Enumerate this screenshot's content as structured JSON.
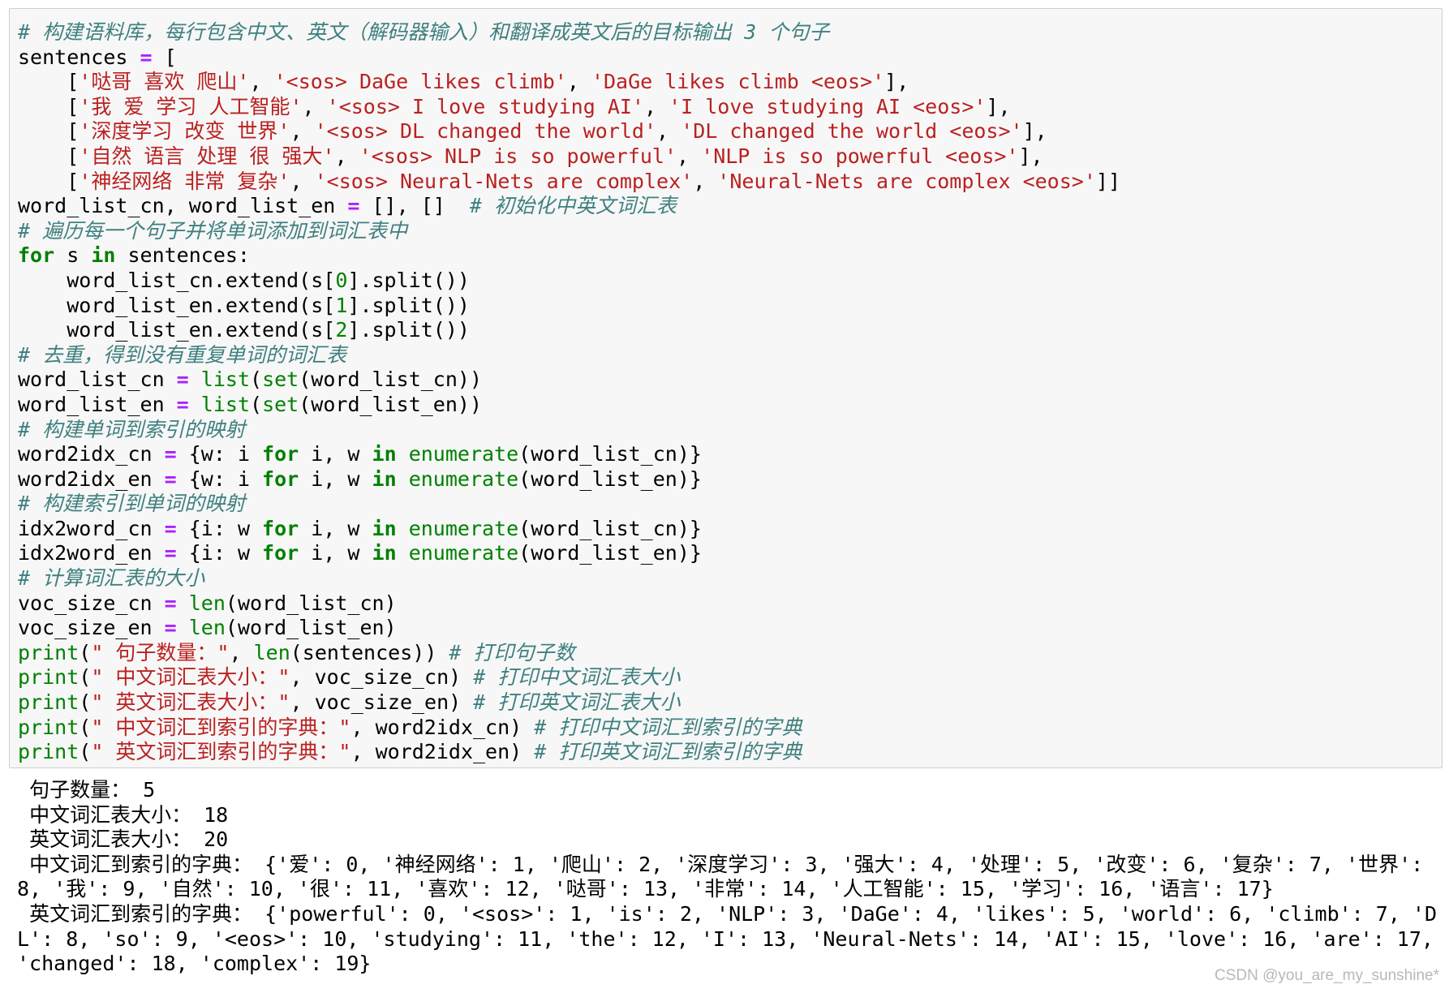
{
  "cell": {
    "code_lines": [
      [
        {
          "t": "# 构建语料库，每行包含中文、英文（解码器输入）和翻译成英文后的目标输出 3 个句子",
          "c": "cm"
        }
      ],
      [
        {
          "t": "sentences ",
          "c": "nm"
        },
        {
          "t": "=",
          "c": "op"
        },
        {
          "t": " [",
          "c": "nm"
        }
      ],
      [
        {
          "t": "    [",
          "c": "nm"
        },
        {
          "t": "'哒哥 喜欢 爬山'",
          "c": "st"
        },
        {
          "t": ", ",
          "c": "nm"
        },
        {
          "t": "'<sos> DaGe likes climb'",
          "c": "st"
        },
        {
          "t": ", ",
          "c": "nm"
        },
        {
          "t": "'DaGe likes climb <eos>'",
          "c": "st"
        },
        {
          "t": "],",
          "c": "nm"
        }
      ],
      [
        {
          "t": "    [",
          "c": "nm"
        },
        {
          "t": "'我 爱 学习 人工智能'",
          "c": "st"
        },
        {
          "t": ", ",
          "c": "nm"
        },
        {
          "t": "'<sos> I love studying AI'",
          "c": "st"
        },
        {
          "t": ", ",
          "c": "nm"
        },
        {
          "t": "'I love studying AI <eos>'",
          "c": "st"
        },
        {
          "t": "],",
          "c": "nm"
        }
      ],
      [
        {
          "t": "    [",
          "c": "nm"
        },
        {
          "t": "'深度学习 改变 世界'",
          "c": "st"
        },
        {
          "t": ", ",
          "c": "nm"
        },
        {
          "t": "'<sos> DL changed the world'",
          "c": "st"
        },
        {
          "t": ", ",
          "c": "nm"
        },
        {
          "t": "'DL changed the world <eos>'",
          "c": "st"
        },
        {
          "t": "],",
          "c": "nm"
        }
      ],
      [
        {
          "t": "    [",
          "c": "nm"
        },
        {
          "t": "'自然 语言 处理 很 强大'",
          "c": "st"
        },
        {
          "t": ", ",
          "c": "nm"
        },
        {
          "t": "'<sos> NLP is so powerful'",
          "c": "st"
        },
        {
          "t": ", ",
          "c": "nm"
        },
        {
          "t": "'NLP is so powerful <eos>'",
          "c": "st"
        },
        {
          "t": "],",
          "c": "nm"
        }
      ],
      [
        {
          "t": "    [",
          "c": "nm"
        },
        {
          "t": "'神经网络 非常 复杂'",
          "c": "st"
        },
        {
          "t": ", ",
          "c": "nm"
        },
        {
          "t": "'<sos> Neural-Nets are complex'",
          "c": "st"
        },
        {
          "t": ", ",
          "c": "nm"
        },
        {
          "t": "'Neural-Nets are complex <eos>'",
          "c": "st"
        },
        {
          "t": "]]",
          "c": "nm"
        }
      ],
      [
        {
          "t": "word_list_cn, word_list_en ",
          "c": "nm"
        },
        {
          "t": "=",
          "c": "op"
        },
        {
          "t": " [], []  ",
          "c": "nm"
        },
        {
          "t": "# 初始化中英文词汇表",
          "c": "cm"
        }
      ],
      [
        {
          "t": "# 遍历每一个句子并将单词添加到词汇表中",
          "c": "cm"
        }
      ],
      [
        {
          "t": "for",
          "c": "kw"
        },
        {
          "t": " s ",
          "c": "nm"
        },
        {
          "t": "in",
          "c": "kw"
        },
        {
          "t": " sentences:",
          "c": "nm"
        }
      ],
      [
        {
          "t": "    word_list_cn.extend(s[",
          "c": "nm"
        },
        {
          "t": "0",
          "c": "nu"
        },
        {
          "t": "].split())",
          "c": "nm"
        }
      ],
      [
        {
          "t": "    word_list_en.extend(s[",
          "c": "nm"
        },
        {
          "t": "1",
          "c": "nu"
        },
        {
          "t": "].split())",
          "c": "nm"
        }
      ],
      [
        {
          "t": "    word_list_en.extend(s[",
          "c": "nm"
        },
        {
          "t": "2",
          "c": "nu"
        },
        {
          "t": "].split())",
          "c": "nm"
        }
      ],
      [
        {
          "t": "# 去重，得到没有重复单词的词汇表",
          "c": "cm"
        }
      ],
      [
        {
          "t": "word_list_cn ",
          "c": "nm"
        },
        {
          "t": "=",
          "c": "op"
        },
        {
          "t": " ",
          "c": "nm"
        },
        {
          "t": "list",
          "c": "bi"
        },
        {
          "t": "(",
          "c": "nm"
        },
        {
          "t": "set",
          "c": "bi"
        },
        {
          "t": "(word_list_cn))",
          "c": "nm"
        }
      ],
      [
        {
          "t": "word_list_en ",
          "c": "nm"
        },
        {
          "t": "=",
          "c": "op"
        },
        {
          "t": " ",
          "c": "nm"
        },
        {
          "t": "list",
          "c": "bi"
        },
        {
          "t": "(",
          "c": "nm"
        },
        {
          "t": "set",
          "c": "bi"
        },
        {
          "t": "(word_list_en))",
          "c": "nm"
        }
      ],
      [
        {
          "t": "# 构建单词到索引的映射",
          "c": "cm"
        }
      ],
      [
        {
          "t": "word2idx_cn ",
          "c": "nm"
        },
        {
          "t": "=",
          "c": "op"
        },
        {
          "t": " {w: i ",
          "c": "nm"
        },
        {
          "t": "for",
          "c": "kw"
        },
        {
          "t": " i, w ",
          "c": "nm"
        },
        {
          "t": "in",
          "c": "kw"
        },
        {
          "t": " ",
          "c": "nm"
        },
        {
          "t": "enumerate",
          "c": "bi"
        },
        {
          "t": "(word_list_cn)}",
          "c": "nm"
        }
      ],
      [
        {
          "t": "word2idx_en ",
          "c": "nm"
        },
        {
          "t": "=",
          "c": "op"
        },
        {
          "t": " {w: i ",
          "c": "nm"
        },
        {
          "t": "for",
          "c": "kw"
        },
        {
          "t": " i, w ",
          "c": "nm"
        },
        {
          "t": "in",
          "c": "kw"
        },
        {
          "t": " ",
          "c": "nm"
        },
        {
          "t": "enumerate",
          "c": "bi"
        },
        {
          "t": "(word_list_en)}",
          "c": "nm"
        }
      ],
      [
        {
          "t": "# 构建索引到单词的映射",
          "c": "cm"
        }
      ],
      [
        {
          "t": "idx2word_cn ",
          "c": "nm"
        },
        {
          "t": "=",
          "c": "op"
        },
        {
          "t": " {i: w ",
          "c": "nm"
        },
        {
          "t": "for",
          "c": "kw"
        },
        {
          "t": " i, w ",
          "c": "nm"
        },
        {
          "t": "in",
          "c": "kw"
        },
        {
          "t": " ",
          "c": "nm"
        },
        {
          "t": "enumerate",
          "c": "bi"
        },
        {
          "t": "(word_list_cn)}",
          "c": "nm"
        }
      ],
      [
        {
          "t": "idx2word_en ",
          "c": "nm"
        },
        {
          "t": "=",
          "c": "op"
        },
        {
          "t": " {i: w ",
          "c": "nm"
        },
        {
          "t": "for",
          "c": "kw"
        },
        {
          "t": " i, w ",
          "c": "nm"
        },
        {
          "t": "in",
          "c": "kw"
        },
        {
          "t": " ",
          "c": "nm"
        },
        {
          "t": "enumerate",
          "c": "bi"
        },
        {
          "t": "(word_list_en)}",
          "c": "nm"
        }
      ],
      [
        {
          "t": "# 计算词汇表的大小",
          "c": "cm"
        }
      ],
      [
        {
          "t": "voc_size_cn ",
          "c": "nm"
        },
        {
          "t": "=",
          "c": "op"
        },
        {
          "t": " ",
          "c": "nm"
        },
        {
          "t": "len",
          "c": "bi"
        },
        {
          "t": "(word_list_cn)",
          "c": "nm"
        }
      ],
      [
        {
          "t": "voc_size_en ",
          "c": "nm"
        },
        {
          "t": "=",
          "c": "op"
        },
        {
          "t": " ",
          "c": "nm"
        },
        {
          "t": "len",
          "c": "bi"
        },
        {
          "t": "(word_list_en)",
          "c": "nm"
        }
      ],
      [
        {
          "t": "print",
          "c": "bi"
        },
        {
          "t": "(",
          "c": "nm"
        },
        {
          "t": "\" 句子数量：\"",
          "c": "st"
        },
        {
          "t": ", ",
          "c": "nm"
        },
        {
          "t": "len",
          "c": "bi"
        },
        {
          "t": "(sentences)) ",
          "c": "nm"
        },
        {
          "t": "# 打印句子数",
          "c": "cm"
        }
      ],
      [
        {
          "t": "print",
          "c": "bi"
        },
        {
          "t": "(",
          "c": "nm"
        },
        {
          "t": "\" 中文词汇表大小：\"",
          "c": "st"
        },
        {
          "t": ", voc_size_cn) ",
          "c": "nm"
        },
        {
          "t": "# 打印中文词汇表大小",
          "c": "cm"
        }
      ],
      [
        {
          "t": "print",
          "c": "bi"
        },
        {
          "t": "(",
          "c": "nm"
        },
        {
          "t": "\" 英文词汇表大小：\"",
          "c": "st"
        },
        {
          "t": ", voc_size_en) ",
          "c": "nm"
        },
        {
          "t": "# 打印英文词汇表大小",
          "c": "cm"
        }
      ],
      [
        {
          "t": "print",
          "c": "bi"
        },
        {
          "t": "(",
          "c": "nm"
        },
        {
          "t": "\" 中文词汇到索引的字典：\"",
          "c": "st"
        },
        {
          "t": ", word2idx_cn) ",
          "c": "nm"
        },
        {
          "t": "# 打印中文词汇到索引的字典",
          "c": "cm"
        }
      ],
      [
        {
          "t": "print",
          "c": "bi"
        },
        {
          "t": "(",
          "c": "nm"
        },
        {
          "t": "\" 英文词汇到索引的字典：\"",
          "c": "st"
        },
        {
          "t": ", word2idx_en) ",
          "c": "nm"
        },
        {
          "t": "# 打印英文词汇到索引的字典",
          "c": "cm"
        }
      ]
    ]
  },
  "output": {
    "lines": [
      " 句子数量： 5",
      " 中文词汇表大小： 18",
      " 英文词汇表大小： 20",
      " 中文词汇到索引的字典： {'爱': 0, '神经网络': 1, '爬山': 2, '深度学习': 3, '强大': 4, '处理': 5, '改变': 6, '复杂': 7, '世界': 8, '我': 9, '自然': 10, '很': 11, '喜欢': 12, '哒哥': 13, '非常': 14, '人工智能': 15, '学习': 16, '语言': 17}",
      " 英文词汇到索引的字典： {'powerful': 0, '<sos>': 1, 'is': 2, 'NLP': 3, 'DaGe': 4, 'likes': 5, 'world': 6, 'climb': 7, 'DL': 8, 'so': 9, '<eos>': 10, 'studying': 11, 'the': 12, 'I': 13, 'Neural-Nets': 14, 'AI': 15, 'love': 16, 'are': 17, 'changed': 18, 'complex': 19}"
    ]
  },
  "watermark": "CSDN @you_are_my_sunshine*",
  "colors": {
    "comment": "#408080",
    "keyword": "#008000",
    "string": "#BA2121",
    "operator": "#AA22FF",
    "cell_bg": "#f7f7f7"
  }
}
